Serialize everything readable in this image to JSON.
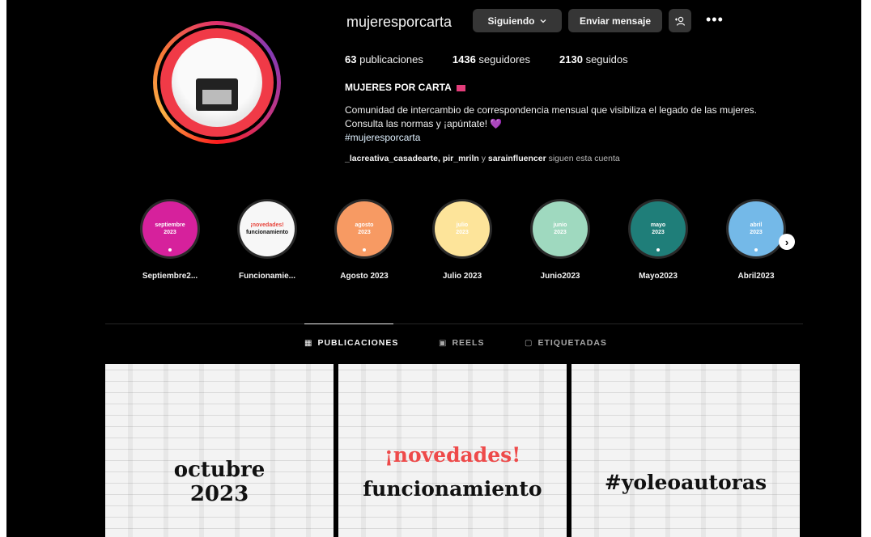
{
  "profile": {
    "username": "mujeresporcarta",
    "follow_button": "Siguiendo",
    "message_button": "Enviar mensaje",
    "more": "•••",
    "stats": {
      "posts_count": "63",
      "posts_label": "publicaciones",
      "followers_count": "1436",
      "followers_label": "seguidores",
      "following_count": "2130",
      "following_label": "seguidos"
    },
    "name": "MUJERES POR CARTA",
    "bio_line1": "Comunidad de intercambio de correspondencia mensual que visibiliza el legado de las mujeres.",
    "bio_line2": "Consulta las normas y ¡apúntate! 💜",
    "bio_tag": "#mujeresporcarta",
    "followed_by": {
      "names": "_lacreativa_casadearte, pir_mriln",
      "and": "y",
      "last": "sarainfluencer",
      "suffix": "siguen esta cuenta"
    }
  },
  "highlights": [
    {
      "label": "Septiembre2...",
      "inner_top": "septiembre",
      "inner_bottom": "2023",
      "color": "#d6219c",
      "text_color": "#ffffff"
    },
    {
      "label": "Funcionamie...",
      "inner_top": "¡novedades!",
      "inner_bottom": "funcionamiento",
      "color": "#f7f7f7",
      "text_color": "#111111"
    },
    {
      "label": "Agosto 2023",
      "inner_top": "agosto",
      "inner_bottom": "2023",
      "color": "#f79a63",
      "text_color": "#ffffff"
    },
    {
      "label": "Julio 2023",
      "inner_top": "julio",
      "inner_bottom": "2023",
      "color": "#fde49a",
      "text_color": "#ffffff"
    },
    {
      "label": "Junio2023",
      "inner_top": "junio",
      "inner_bottom": "2023",
      "color": "#9fd9bf",
      "text_color": "#ffffff"
    },
    {
      "label": "Mayo2023",
      "inner_top": "mayo",
      "inner_bottom": "2023",
      "color": "#1f7e79",
      "text_color": "#ffffff"
    },
    {
      "label": "Abril2023",
      "inner_top": "abril",
      "inner_bottom": "2023",
      "color": "#74b9e8",
      "text_color": "#ffffff"
    }
  ],
  "tabs": [
    {
      "label": "PUBLICACIONES",
      "icon": "grid-icon",
      "glyph": "▦"
    },
    {
      "label": "REELS",
      "icon": "reels-icon",
      "glyph": "▣"
    },
    {
      "label": "ETIQUETADAS",
      "icon": "tagged-icon",
      "glyph": "▢"
    }
  ],
  "posts": [
    {
      "line1": "octubre",
      "line2": "2023"
    },
    {
      "line1": "¡novedades!",
      "line2": "funcionamiento"
    },
    {
      "line1": "#yoleoautoras"
    }
  ],
  "colors": {
    "accent_red": "#ee4a4a",
    "background": "#000000",
    "button_bg": "#363636"
  }
}
